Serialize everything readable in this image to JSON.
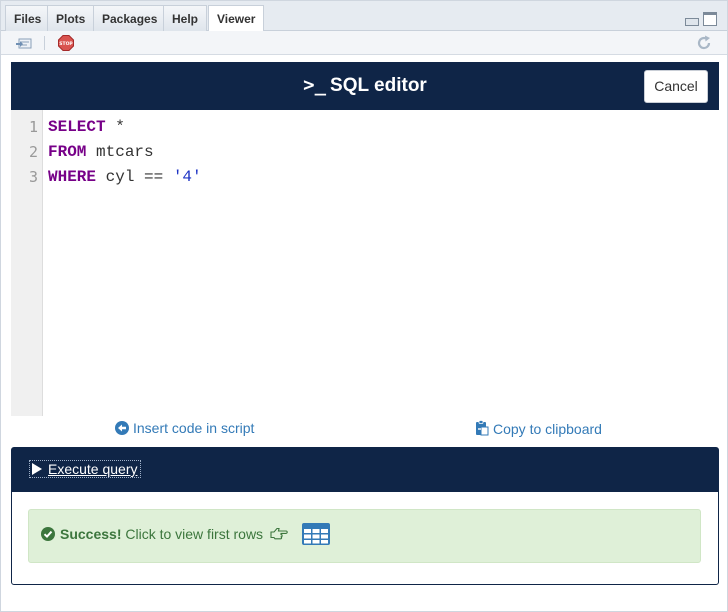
{
  "tabs": [
    {
      "label": "Files"
    },
    {
      "label": "Plots"
    },
    {
      "label": "Packages"
    },
    {
      "label": "Help"
    },
    {
      "label": "Viewer",
      "active": true
    }
  ],
  "toolbar": {
    "export_icon": "export-icon",
    "stop_icon": "stop-icon",
    "stop_label": "STOP",
    "refresh_icon": "refresh-icon"
  },
  "header": {
    "prompt": ">_",
    "title": "SQL editor",
    "cancel_label": "Cancel"
  },
  "editor": {
    "lines": [
      {
        "num": "1",
        "keyword": "SELECT",
        "rest": " *",
        "string": ""
      },
      {
        "num": "2",
        "keyword": "FROM",
        "rest": " mtcars",
        "string": ""
      },
      {
        "num": "3",
        "keyword": "WHERE",
        "rest": " cyl == ",
        "string": "'4'"
      }
    ]
  },
  "actions": {
    "insert_label": "Insert code in script",
    "copy_label": "Copy to clipboard"
  },
  "results": {
    "execute_label": "Execute query",
    "success_strong": "Success!",
    "success_text": " Click to view first rows",
    "colors": {
      "success_bg": "#dff0d8",
      "success_text": "#3c763d",
      "header_bg": "#0f2547",
      "link": "#337ab7"
    }
  }
}
